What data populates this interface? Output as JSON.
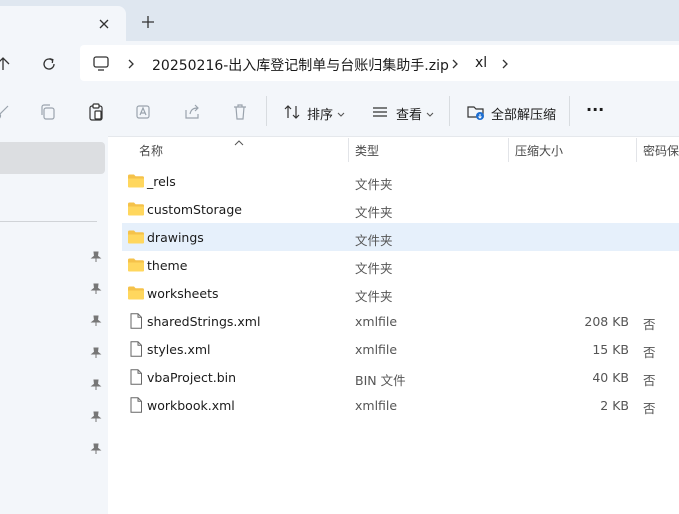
{
  "tabs": {
    "new_tab_symbol": "+",
    "close_symbol": "✕"
  },
  "breadcrumb": {
    "items": [
      "20250216-出入库登记制单与台账归集助手.zip",
      "xl"
    ]
  },
  "commands": {
    "sort_label": "排序",
    "view_label": "查看",
    "extract_all_label": "全部解压缩",
    "more_label": "···"
  },
  "columns": {
    "name": "名称",
    "type": "类型",
    "compressed_size": "压缩大小",
    "password_protected": "密码保"
  },
  "files": [
    {
      "name": "_rels",
      "type": "文件夹",
      "size": "",
      "protected": "",
      "icon": "folder-icon"
    },
    {
      "name": "customStorage",
      "type": "文件夹",
      "size": "",
      "protected": "",
      "icon": "folder-icon"
    },
    {
      "name": "drawings",
      "type": "文件夹",
      "size": "",
      "protected": "",
      "icon": "folder-icon"
    },
    {
      "name": "theme",
      "type": "文件夹",
      "size": "",
      "protected": "",
      "icon": "folder-icon"
    },
    {
      "name": "worksheets",
      "type": "文件夹",
      "size": "",
      "protected": "",
      "icon": "folder-icon"
    },
    {
      "name": "sharedStrings.xml",
      "type": "xmlfile",
      "size": "208 KB",
      "protected": "否",
      "icon": "file-icon"
    },
    {
      "name": "styles.xml",
      "type": "xmlfile",
      "size": "15 KB",
      "protected": "否",
      "icon": "file-icon"
    },
    {
      "name": "vbaProject.bin",
      "type": "BIN 文件",
      "size": "40 KB",
      "protected": "否",
      "icon": "file-icon"
    },
    {
      "name": "workbook.xml",
      "type": "xmlfile",
      "size": "2 KB",
      "protected": "否",
      "icon": "file-icon"
    }
  ],
  "colors": {
    "folder": "#f5c24a",
    "selection": "#e6f0fb",
    "chrome": "#f3f6fa",
    "tabstrip": "#dfe7f0"
  }
}
